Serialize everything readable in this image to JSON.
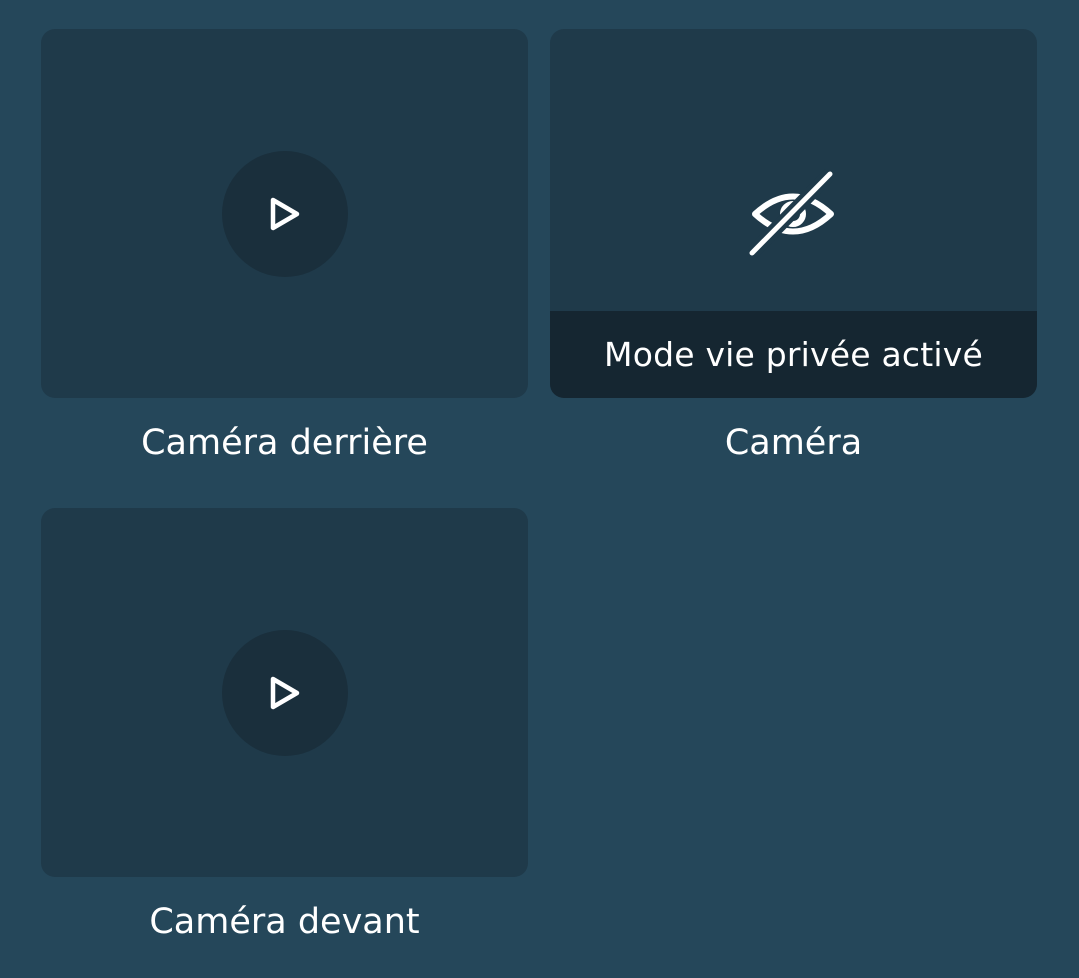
{
  "cameras": [
    {
      "name": "Caméra derrière",
      "status": "playable",
      "icon": "play-icon"
    },
    {
      "name": "Caméra",
      "status": "privacy",
      "icon": "eye-slash-icon",
      "overlay_text": "Mode vie privée activé"
    },
    {
      "name": "Caméra devant",
      "status": "playable",
      "icon": "play-icon"
    }
  ],
  "colors": {
    "background": "#25475a",
    "card": "#1f3a4a",
    "play_circle": "#1a2f3c",
    "privacy_bar": "#152631",
    "text": "#ffffff"
  }
}
